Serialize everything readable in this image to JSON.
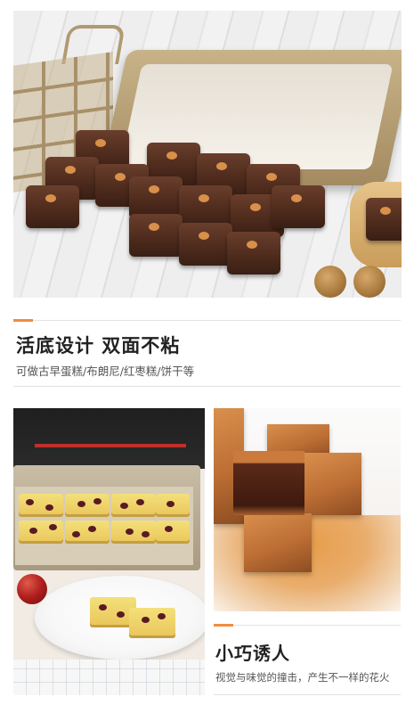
{
  "section1": {
    "title": "活底设计  双面不粘",
    "subtitle": "可做古早蛋糕/布朗尼/红枣糕/饼干等"
  },
  "section2": {
    "title": "小巧诱人",
    "subtitle": "视觉与味觉的撞击，产生不一样的花火"
  },
  "colors": {
    "accent": "#f08c3c",
    "divider": "#e2e2e2",
    "title": "#222222",
    "subtitle": "#555555"
  }
}
